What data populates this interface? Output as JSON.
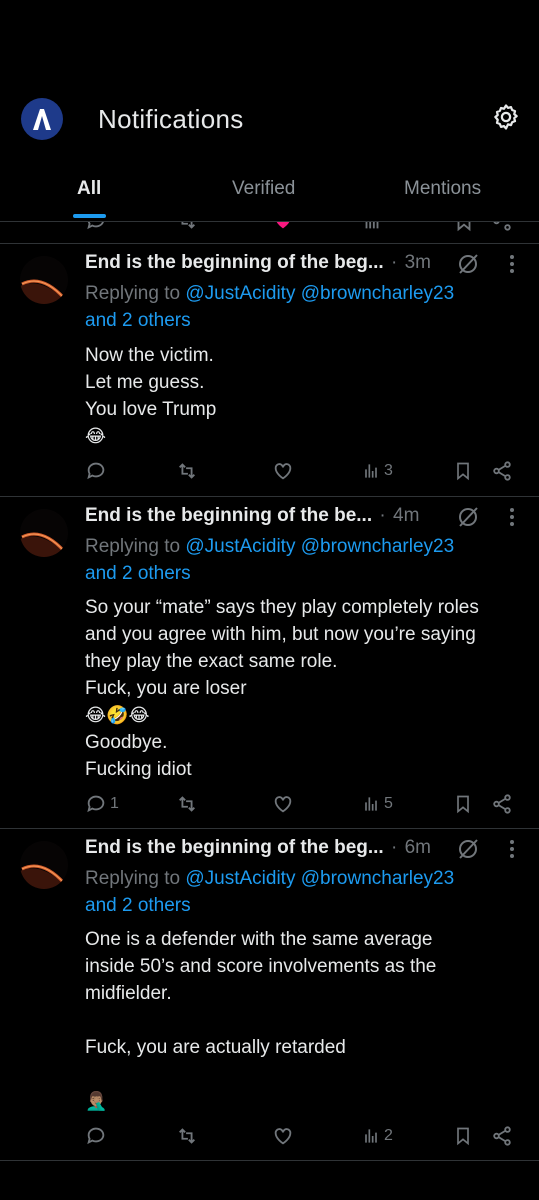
{
  "header": {
    "title": "Notifications",
    "logo_icon": "app-logo-icon",
    "settings_icon": "gear-icon",
    "accent": "#1d9bf0"
  },
  "tabs": [
    {
      "label": "All",
      "active": true
    },
    {
      "label": "Verified",
      "active": false
    },
    {
      "label": "Mentions",
      "active": false
    }
  ],
  "tweets": [
    {
      "name": "End is the beginning of the beg...",
      "separator": "·",
      "time": "3m",
      "reply_prefix": "Replying to",
      "reply_handles": [
        "@JustAcidity",
        "@browncharley23"
      ],
      "reply_others": "and 2 others",
      "lines": [
        "Now the victim.",
        "Let me guess.",
        "You love Trump",
        "😂"
      ],
      "replies": "",
      "retweets": "",
      "likes": "",
      "views": "3"
    },
    {
      "name": "End is the beginning of the be...",
      "separator": "·",
      "time": "4m",
      "reply_prefix": "Replying to",
      "reply_handles": [
        "@JustAcidity",
        "@browncharley23"
      ],
      "reply_others": "and 2 others",
      "lines": [
        "So your “mate” says they play completely roles",
        "and you agree with him, but now you’re saying",
        "they play the exact same role.",
        "Fuck, you are loser",
        "😂🤣😂",
        "Goodbye.",
        "Fucking idiot"
      ],
      "replies": "1",
      "retweets": "",
      "likes": "",
      "views": "5"
    },
    {
      "name": "End is the beginning of the beg...",
      "separator": "·",
      "time": "6m",
      "reply_prefix": "Replying to",
      "reply_handles": [
        "@JustAcidity",
        "@browncharley23"
      ],
      "reply_others": "and 2 others",
      "lines": [
        "One is a defender with the same average",
        "inside 50’s and score involvements as the",
        "midfielder.",
        "",
        "Fuck, you are actually retarded",
        "",
        "🤦🏽‍♂️"
      ],
      "replies": "",
      "retweets": "",
      "likes": "",
      "views": "2"
    }
  ]
}
